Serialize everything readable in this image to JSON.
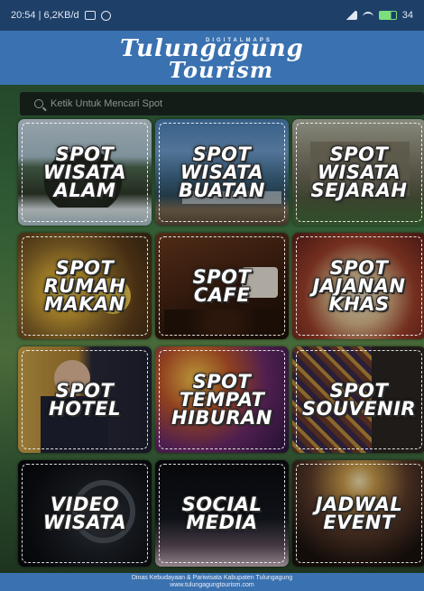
{
  "status_bar": {
    "time_info": "20:54 | 6,2KB/d",
    "battery_text": "34"
  },
  "header": {
    "logo_subtitle": "DIGITALMAPS",
    "logo_line1": "Tulungagung",
    "logo_line2": "Tourism"
  },
  "search": {
    "placeholder": "Ketik Untuk Mencari Spot"
  },
  "tiles": [
    {
      "lines": [
        "SPOT",
        "WISATA",
        "ALAM"
      ],
      "icon": "nature-photo"
    },
    {
      "lines": [
        "SPOT",
        "WISATA",
        "BUATAN"
      ],
      "icon": "lake-photo"
    },
    {
      "lines": [
        "SPOT",
        "WISATA",
        "SEJARAH"
      ],
      "icon": "temple-photo"
    },
    {
      "lines": [
        "SPOT",
        "RUMAH",
        "MAKAN"
      ],
      "icon": "food-photo"
    },
    {
      "lines": [
        "SPOT",
        "CAFE"
      ],
      "icon": "coffee-photo"
    },
    {
      "lines": [
        "SPOT",
        "JAJANAN",
        "KHAS"
      ],
      "icon": "snack-photo"
    },
    {
      "lines": [
        "SPOT",
        "HOTEL"
      ],
      "icon": "hotel-photo"
    },
    {
      "lines": [
        "SPOT",
        "TEMPAT",
        "HIBURAN"
      ],
      "icon": "entertainment-photo"
    },
    {
      "lines": [
        "SPOT",
        "SOUVENIR"
      ],
      "icon": "souvenir-photo"
    },
    {
      "lines": [
        "VIDEO",
        "WISATA"
      ],
      "icon": "camera-lens-photo"
    },
    {
      "lines": [
        "SOCIAL",
        "MEDIA"
      ],
      "icon": "phone-photo"
    },
    {
      "lines": [
        "JADWAL",
        "EVENT"
      ],
      "icon": "concert-photo"
    }
  ],
  "footer": {
    "line1": "Dinas Kebudayaan & Pariwisata Kabupaten Tulungagung",
    "line2": "www.tulungagungtourism.com"
  },
  "colors": {
    "header_blue": "#3a71b0",
    "status_blue": "#1e3f68",
    "search_bg": "#141c17"
  }
}
